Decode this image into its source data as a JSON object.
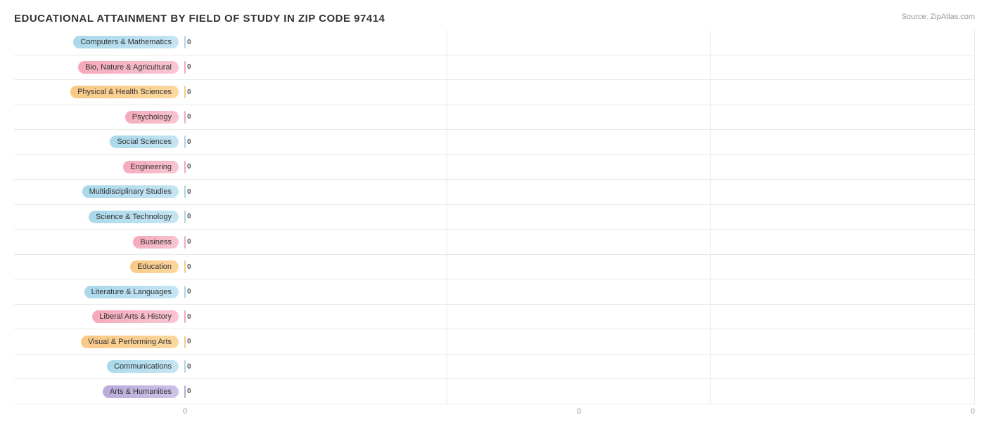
{
  "title": "EDUCATIONAL ATTAINMENT BY FIELD OF STUDY IN ZIP CODE 97414",
  "source": "Source: ZipAtlas.com",
  "bars": [
    {
      "label": "Computers & Mathematics",
      "value": 0,
      "color1": "#a8d8ea",
      "color2": "#c8e6f5",
      "barColor": "#a8d8ea"
    },
    {
      "label": "Bio, Nature & Agricultural",
      "value": 0,
      "color1": "#f4a7b9",
      "color2": "#f8c8d4",
      "barColor": "#f4a7b9"
    },
    {
      "label": "Physical & Health Sciences",
      "value": 0,
      "color1": "#f9c784",
      "color2": "#fbd9a0",
      "barColor": "#f9c784"
    },
    {
      "label": "Psychology",
      "value": 0,
      "color1": "#f4a7b9",
      "color2": "#f8c8d4",
      "barColor": "#f4a7b9"
    },
    {
      "label": "Social Sciences",
      "value": 0,
      "color1": "#a8d8ea",
      "color2": "#c8e6f5",
      "barColor": "#a8d8ea"
    },
    {
      "label": "Engineering",
      "value": 0,
      "color1": "#f4a7b9",
      "color2": "#f8c8d4",
      "barColor": "#f4a7b9"
    },
    {
      "label": "Multidisciplinary Studies",
      "value": 0,
      "color1": "#a8d8ea",
      "color2": "#c8e6f5",
      "barColor": "#a8d8ea"
    },
    {
      "label": "Science & Technology",
      "value": 0,
      "color1": "#a8d8ea",
      "color2": "#c8e6f5",
      "barColor": "#a8d8ea"
    },
    {
      "label": "Business",
      "value": 0,
      "color1": "#f4a7b9",
      "color2": "#f8c8d4",
      "barColor": "#f4a7b9"
    },
    {
      "label": "Education",
      "value": 0,
      "color1": "#f9c784",
      "color2": "#fbd9a0",
      "barColor": "#f9c784"
    },
    {
      "label": "Literature & Languages",
      "value": 0,
      "color1": "#a8d8ea",
      "color2": "#c8e6f5",
      "barColor": "#a8d8ea"
    },
    {
      "label": "Liberal Arts & History",
      "value": 0,
      "color1": "#f4a7b9",
      "color2": "#f8c8d4",
      "barColor": "#f4a7b9"
    },
    {
      "label": "Visual & Performing Arts",
      "value": 0,
      "color1": "#f9c784",
      "color2": "#fbd9a0",
      "barColor": "#f9c784"
    },
    {
      "label": "Communications",
      "value": 0,
      "color1": "#a8d8ea",
      "color2": "#c8e6f5",
      "barColor": "#a8d8ea"
    },
    {
      "label": "Arts & Humanities",
      "value": 0,
      "color1": "#b8a9d9",
      "color2": "#d0c4e8",
      "barColor": "#b8a9d9"
    }
  ],
  "xAxis": [
    "0",
    "0",
    "0"
  ],
  "valueLabel": "0"
}
